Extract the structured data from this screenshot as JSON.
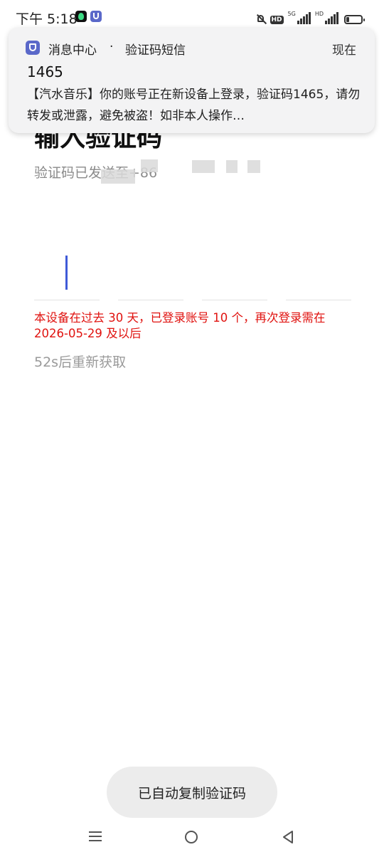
{
  "status_bar": {
    "time": "下午 5:18",
    "hd1": "HD",
    "sig1": "5G",
    "sig2": "HD",
    "battery_level": 0.2,
    "icons": [
      "qq-music-app-icon",
      "shield-app-icon",
      "bell-off-icon",
      "signal-icon",
      "battery-icon"
    ]
  },
  "notification": {
    "app_name": "消息中心",
    "separator": "·",
    "channel": "验证码短信",
    "time": "现在",
    "title": "1465",
    "body": "【汽水音乐】你的账号正在新设备上登录，验证码1465，请勿转发或泄露，避免被盗！如非本人操作…"
  },
  "page": {
    "title": "输入验证码",
    "subtitle": "验证码已发送至+86",
    "warning": "本设备在过去 30 天，已登录账号 10 个，再次登录需在 2026-05-29 及以后",
    "resend": "52s后重新获取"
  },
  "toast": {
    "message": "已自动复制验证码"
  },
  "colors": {
    "accent": "#3f5ad8",
    "warning": "#e0120f",
    "notification_bg": "#f3f3f4",
    "app_icon": "#5a68c9"
  }
}
